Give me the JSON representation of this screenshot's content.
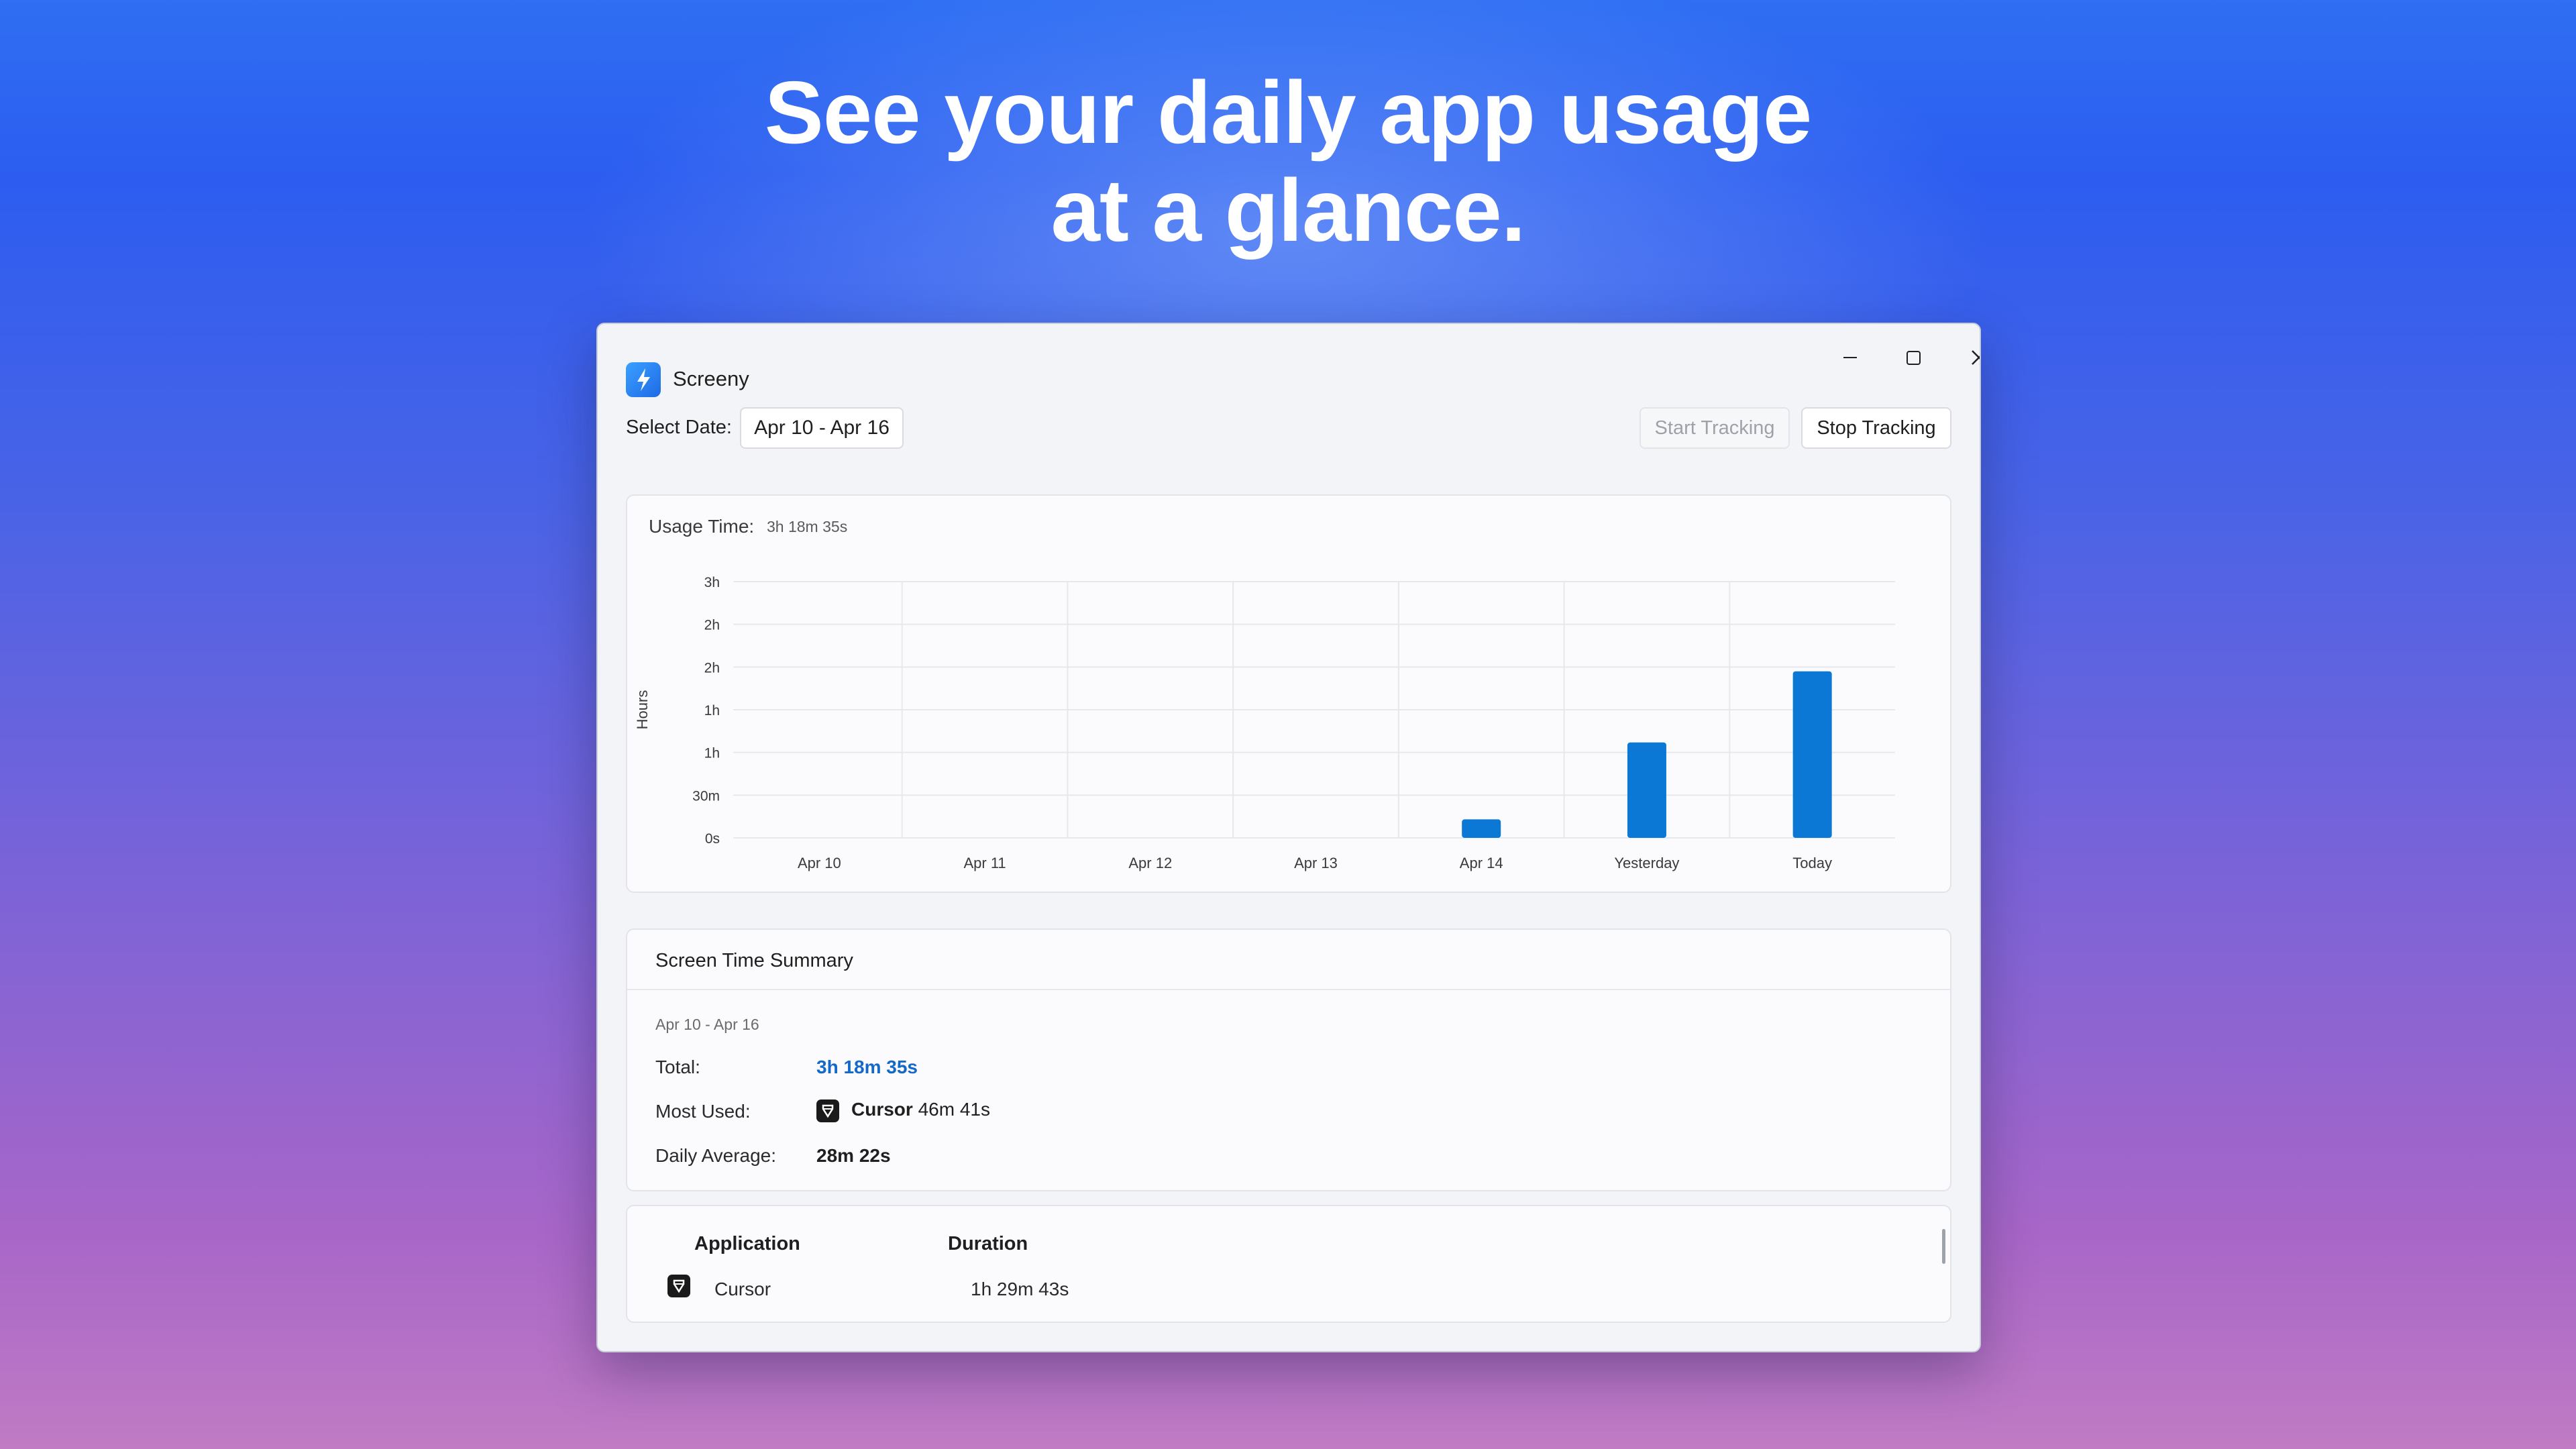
{
  "headline": {
    "line1": "See your daily app usage",
    "line2": "at a glance."
  },
  "window": {
    "app_title": "Screeny",
    "controls": {
      "minimize_icon": "minimize-icon",
      "maximize_icon": "maximize-icon",
      "close_icon": "close-icon"
    }
  },
  "toolbar": {
    "select_date_label": "Select Date:",
    "date_range": "Apr 10 - Apr 16",
    "start_tracking": "Start Tracking",
    "stop_tracking": "Stop Tracking"
  },
  "usage": {
    "label": "Usage Time:",
    "value": "3h 18m 35s"
  },
  "chart_data": {
    "type": "bar",
    "ylabel": "Hours",
    "yticks": [
      "0s",
      "30m",
      "1h",
      "1h",
      "2h",
      "2h",
      "3h"
    ],
    "ylim": [
      0,
      180
    ],
    "categories": [
      "Apr 10",
      "Apr 11",
      "Apr 12",
      "Apr 13",
      "Apr 14",
      "Yesterday",
      "Today"
    ],
    "values": [
      0,
      0,
      0,
      0,
      13,
      67,
      117
    ],
    "value_unit": "minutes",
    "grid": true,
    "bar_color": "#0a78d4"
  },
  "summary": {
    "title": "Screen Time Summary",
    "range": "Apr 10 - Apr 16",
    "total_label": "Total:",
    "total_value": "3h 18m 35s",
    "most_used_label": "Most Used:",
    "most_used_app": "Cursor",
    "most_used_time": "46m 41s",
    "avg_label": "Daily Average:",
    "avg_value": "28m 22s",
    "accent": "#1468c8"
  },
  "table": {
    "headers": [
      "Application",
      "Duration"
    ],
    "rows": [
      {
        "app": "Cursor",
        "duration": "1h 29m 43s",
        "icon": "cursor-app-icon"
      }
    ]
  }
}
